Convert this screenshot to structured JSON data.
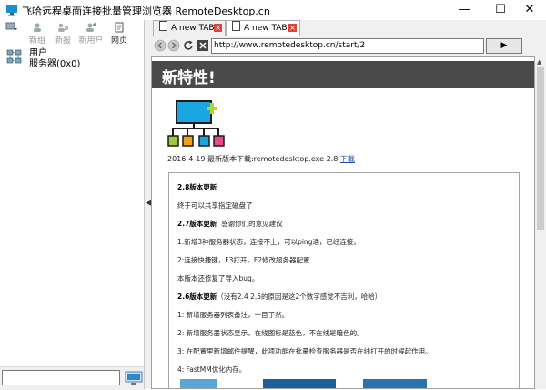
{
  "window": {
    "title": "飞哈远程桌面连接批量管理浏览器 RemoteDesktop.cn",
    "minimize": "—",
    "maximize": "☐",
    "close": "✕"
  },
  "toolbar": {
    "new_group": "新组",
    "new_report": "新报",
    "new_user": "新用户",
    "web": "网页"
  },
  "tree": {
    "root_label": "用户",
    "child_label": "服务器(0x0)"
  },
  "side_search": {
    "value": "",
    "placeholder": ""
  },
  "tabs": [
    {
      "label": "A new TAB"
    },
    {
      "label": "A new TAB"
    }
  ],
  "address": {
    "url": "http://www.remotedesktop.cn/start/2",
    "go": "▶"
  },
  "page": {
    "heading": "新特性!",
    "release_line": "2016-4-19 最新版本下载:remotedesktop.exe 2.8",
    "download_link": "下载",
    "notes": {
      "v28_title": "2.8版本更新",
      "v28_l1": "终于可以共享指定磁盘了",
      "v27_title": "2.7版本更新",
      "v27_suffix": "感谢你们的意见建议",
      "v27_l1": "1:新增3种服务器状态，连接不上，可以ping通，已经连接。",
      "v27_l2": "2:连接快捷键，F3打开，F2修改服务器配置",
      "v27_l3": "本版本还修复了导入bug。",
      "v26_title": "2.6版本更新",
      "v26_suffix": "（没有2.4 2.5的原因是这2个数字感觉不吉利，哈哈）",
      "v26_l1": "1:   新增服务器列表备注，一目了然。",
      "v26_l2": "2:   新增服务器状态显示，在线图标是蓝色，不在线是暗色的。",
      "v26_l3": "3: 在配置里新增邮件提醒，此项功能在批量检查服务器是否在线打开的时候起作用。",
      "v26_l4": "4:   FastMM优化内存。"
    }
  },
  "colors": {
    "header_band": "#4a4a4a",
    "tab_close": "#d9443b",
    "link": "#1a4fa8",
    "hero_screen": "#1aa6e0",
    "hero_plus": "#b5d334",
    "hero_box1": "#a4c639",
    "hero_box2": "#f0a01c",
    "hero_box3": "#1aa6e0",
    "hero_box4": "#e8498a"
  }
}
